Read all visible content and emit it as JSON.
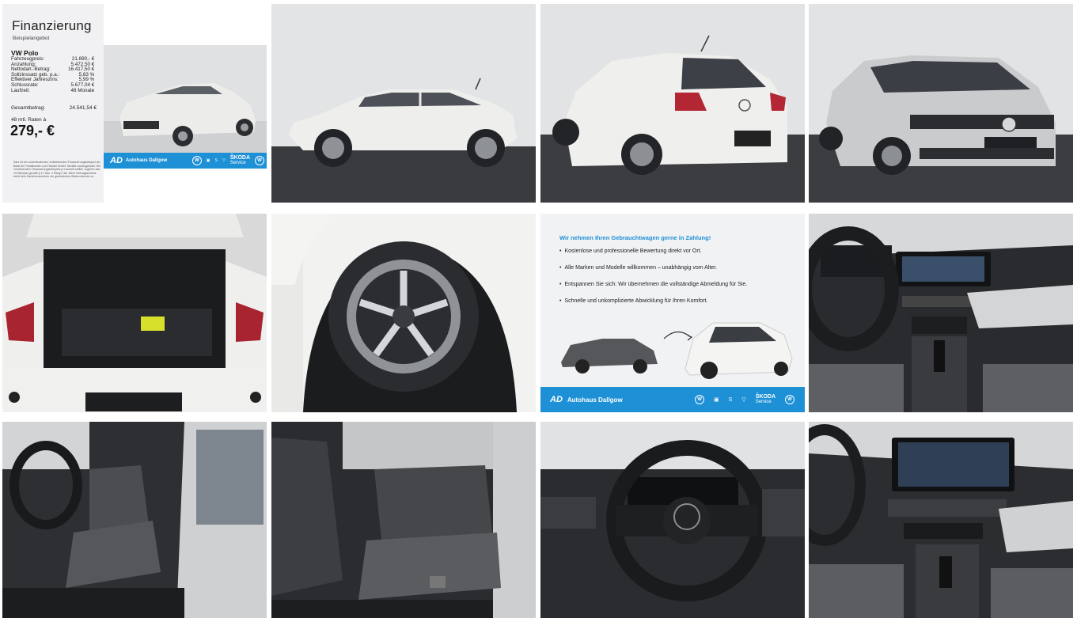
{
  "finance": {
    "title": "Finanzierung",
    "subtitle": "Beispielangebot",
    "model": "VW Polo",
    "rows": [
      {
        "label": "Fahrzeugpreis:",
        "value": "21.890,- €"
      },
      {
        "label": "Anzahlung:",
        "value": "5.472,50 €"
      },
      {
        "label": "Nettodarl.-Betrag:",
        "value": "16.417,50 €"
      },
      {
        "label": "Sollzinssatz geb. p.a.:",
        "value": "5,83 %"
      },
      {
        "label": "Effektiver Jahreszins:",
        "value": "5,99 %"
      },
      {
        "label": "Schlussrate:",
        "value": "5.677,04 €"
      },
      {
        "label": "Laufzeit:",
        "value": "48 Monate"
      }
    ],
    "total_label": "Gesamtbetrag:",
    "total_value": "24.541,54 €",
    "rate_label": "48 mtl. Raten à",
    "rate_value": "279,- €",
    "fineprint": "Dies ist ein unverbindliches, freibleibendes Finanzierungsbeispiel der Bank für Privatkunden und Handel GmbH. Bonität vorausgesetzt. Die vorstehenden Finanzierungsbeispiele je Laufzeit stellen zugleich das 2/3 Beispiel gemäß § 17 Abs. 4 PAngV dar. Nach Vertragsschluss steht dem Darlehensnehmer ein gesetzliches Widerrufsrecht zu.",
    "dealer": "Autohaus Dallgow",
    "skoda_label": "ŠKODA",
    "skoda_sub": "Service"
  },
  "trade_in": {
    "heading": "Wir nehmen Ihren Gebrauchtwagen gerne in Zahlung!",
    "bullets": [
      "Kostenlose und professionelle Bewertung direkt vor Ort.",
      "Alle Marken und Modelle willkommen – unabhängig vom Alter.",
      "Entspannen Sie sich: Wir übernehmen die vollständige Abmeldung für Sie.",
      "Schnelle und unkomplizierte Abwicklung für Ihren Komfort."
    ],
    "dealer": "Autohaus Dallgow",
    "skoda_label": "ŠKODA",
    "skoda_sub": "Service"
  },
  "photos": [
    {
      "id": "side-view",
      "label": "Polo side view"
    },
    {
      "id": "rear-view",
      "label": "Polo rear view"
    },
    {
      "id": "front-view",
      "label": "Polo front view"
    },
    {
      "id": "trunk",
      "label": "Open trunk"
    },
    {
      "id": "wheel",
      "label": "Alloy wheel"
    },
    {
      "id": "dashboard",
      "label": "Dashboard"
    },
    {
      "id": "front-seats",
      "label": "Front seats"
    },
    {
      "id": "rear-seats",
      "label": "Rear seats"
    },
    {
      "id": "steering-wheel",
      "label": "Steering wheel"
    },
    {
      "id": "infotainment",
      "label": "Infotainment"
    }
  ],
  "colors": {
    "accent": "#1e90d6",
    "car_body": "#e8e8e6",
    "floor": "#3c3d40",
    "backdrop": "#e2e3e5"
  }
}
